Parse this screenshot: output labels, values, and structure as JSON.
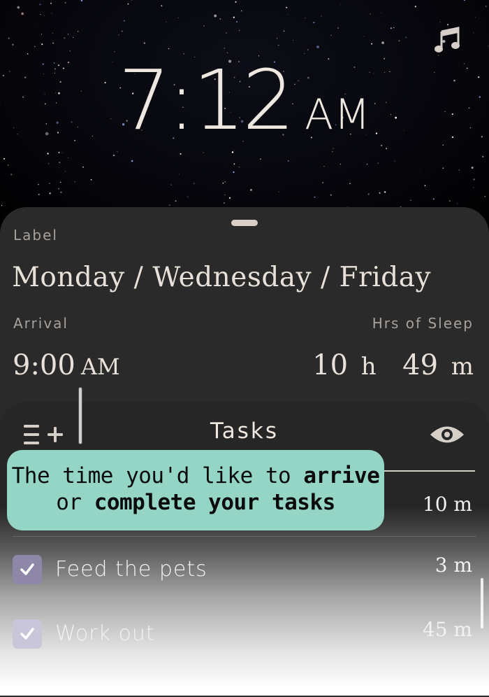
{
  "clock": {
    "time": "7:12",
    "ampm": "AM"
  },
  "icons": {
    "music": "music-note-icon",
    "add": "list-add-icon",
    "eye": "eye-icon",
    "check": "checkmark-icon"
  },
  "sheet": {
    "label_title": "Label",
    "label_value": "Monday / Wednesday / Friday",
    "arrival_title": "Arrival",
    "arrival_time": "9:00",
    "arrival_ampm": "AM",
    "sleep_title": "Hrs of Sleep",
    "sleep_hours": "10",
    "sleep_hours_unit": "h",
    "sleep_minutes": "49",
    "sleep_minutes_unit": "m"
  },
  "tasks": {
    "title": "Tasks",
    "items": [
      {
        "name": "",
        "duration": "10 m",
        "checked": true
      },
      {
        "name": "Feed the pets",
        "duration": "3 m",
        "checked": true
      },
      {
        "name": "Work out",
        "duration": "45 m",
        "checked": true
      }
    ]
  },
  "tooltip": {
    "line1_pre": "The time you'd like to ",
    "line1_bold": "arrive",
    "line2_pre": "or ",
    "line2_bold": "complete your tasks"
  },
  "colors": {
    "sheet_bg": "#2a2a2a",
    "tooltip_bg": "#95d5c6",
    "checkbox_bg": "#8f87a8",
    "text_light": "#e8e1d9"
  }
}
